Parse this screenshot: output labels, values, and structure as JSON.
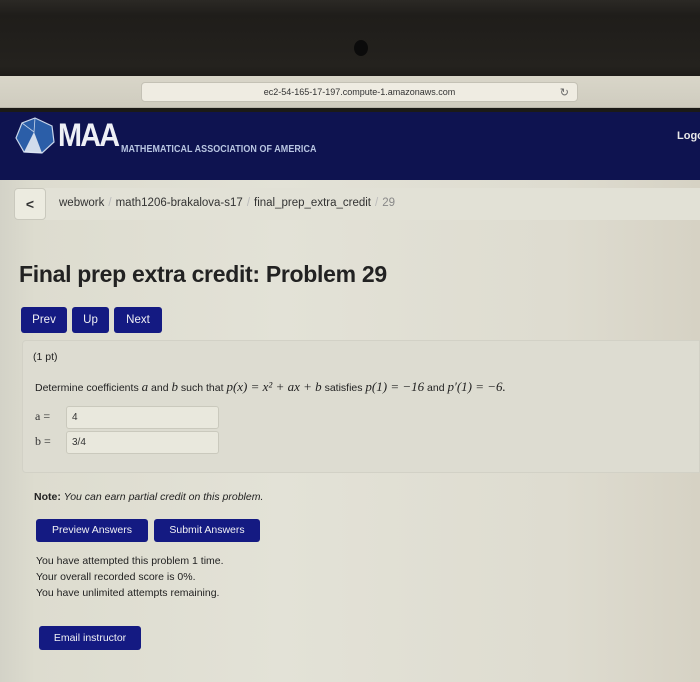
{
  "browser": {
    "url": "ec2-54-165-17-197.compute-1.amazonaws.com",
    "reload_icon": "reload-icon"
  },
  "header": {
    "logo_text": "MAA",
    "logo_subtitle": "MATHEMATICAL ASSOCIATION OF AMERICA",
    "logout_label": "Logo"
  },
  "breadcrumb": {
    "back_label": "<",
    "items": [
      "webwork",
      "math1206-brakalova-s17",
      "final_prep_extra_credit",
      "29"
    ],
    "separator": "/"
  },
  "page": {
    "title": "Final prep extra credit: Problem 29"
  },
  "nav": {
    "prev": "Prev",
    "up": "Up",
    "next": "Next"
  },
  "problem": {
    "points": "(1 pt)",
    "text_prefix": "Determine coefficients",
    "var_a": "a",
    "text_and": "and",
    "var_b": "b",
    "text_such_that": "such that",
    "polynomial": "p(x) = x² + ax + b",
    "text_satisfies": "satisfies",
    "condition1": "p(1) = −16",
    "text_and2": "and",
    "condition2": "p′(1) = −6.",
    "answers": [
      {
        "label": "a =",
        "value": "4"
      },
      {
        "label": "b =",
        "value": "3/4"
      }
    ]
  },
  "note": {
    "label": "Note:",
    "text": "You can earn partial credit on this problem."
  },
  "actions": {
    "preview": "Preview Answers",
    "submit": "Submit Answers",
    "email": "Email instructor"
  },
  "status": {
    "attempts": "You have attempted this problem 1 time.",
    "score": "Your overall recorded score is 0%.",
    "remaining": "You have unlimited attempts remaining."
  },
  "colors": {
    "header_bg": "#0e1350",
    "button_bg": "#141a82",
    "page_bg": "#e3e2d7"
  }
}
